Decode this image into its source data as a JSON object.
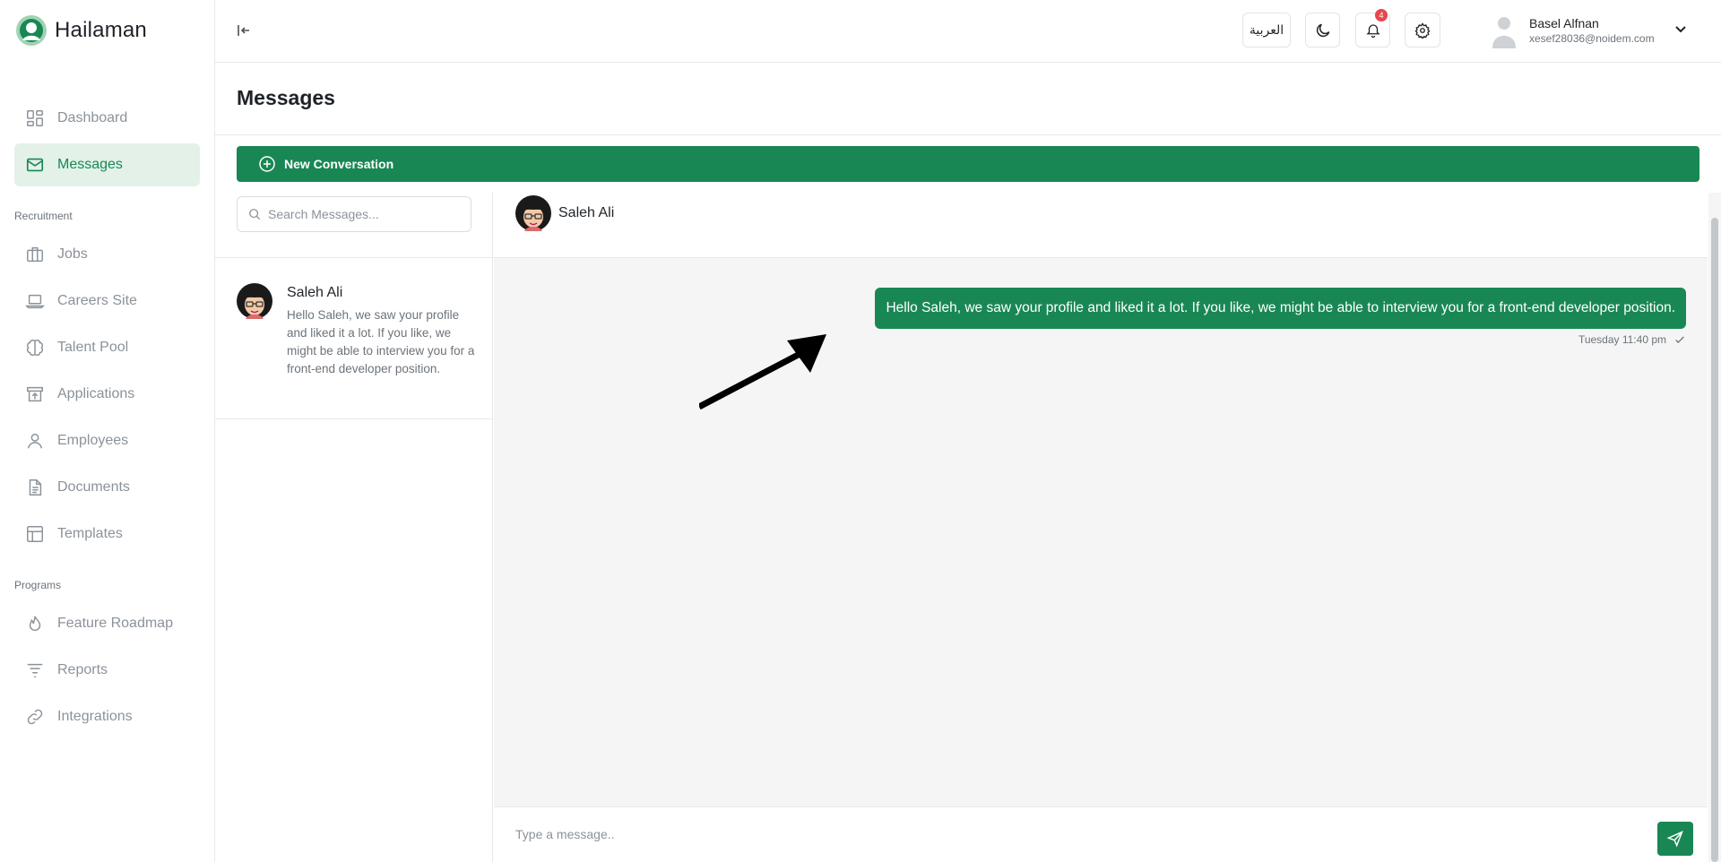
{
  "app": {
    "name": "Hailaman"
  },
  "colors": {
    "brand": "#198754",
    "brand_tint": "#e3f1e8",
    "chat_bg": "#f5f5f5",
    "badge": "#e5484d"
  },
  "sidebar": {
    "items_main": [
      {
        "label": "Dashboard",
        "icon": "dashboard-icon",
        "active": false
      },
      {
        "label": "Messages",
        "icon": "mail-icon",
        "active": true
      }
    ],
    "section_recruitment": "Recruitment",
    "items_recruitment": [
      {
        "label": "Jobs",
        "icon": "briefcase-icon"
      },
      {
        "label": "Careers Site",
        "icon": "laptop-icon"
      },
      {
        "label": "Talent Pool",
        "icon": "brain-icon"
      },
      {
        "label": "Applications",
        "icon": "inbox-upload-icon"
      },
      {
        "label": "Employees",
        "icon": "user-icon"
      },
      {
        "label": "Documents",
        "icon": "document-icon"
      },
      {
        "label": "Templates",
        "icon": "layout-icon"
      }
    ],
    "section_programs": "Programs",
    "items_programs": [
      {
        "label": "Feature Roadmap",
        "icon": "flame-icon"
      },
      {
        "label": "Reports",
        "icon": "filter-icon"
      },
      {
        "label": "Integrations",
        "icon": "link-icon"
      }
    ]
  },
  "topbar": {
    "language_label": "العربية",
    "notifications_count": "4",
    "user": {
      "name": "Basel Alfnan",
      "email": "xesef28036@noidem.com"
    }
  },
  "page": {
    "title": "Messages",
    "new_conversation_label": "New Conversation"
  },
  "conversations": {
    "search_placeholder": "Search Messages...",
    "items": [
      {
        "name": "Saleh Ali",
        "preview": "Hello Saleh, we saw your profile and liked it a lot. If you like, we might be able to interview you for a front-end developer position."
      }
    ]
  },
  "chat": {
    "contact_name": "Saleh Ali",
    "messages": [
      {
        "text": "Hello Saleh, we saw your profile and liked it a lot. If you like, we might be able to interview you for a front-end developer position.",
        "time": "Tuesday 11:40 pm",
        "status": "sent"
      }
    ],
    "composer_placeholder": "Type a message.."
  }
}
